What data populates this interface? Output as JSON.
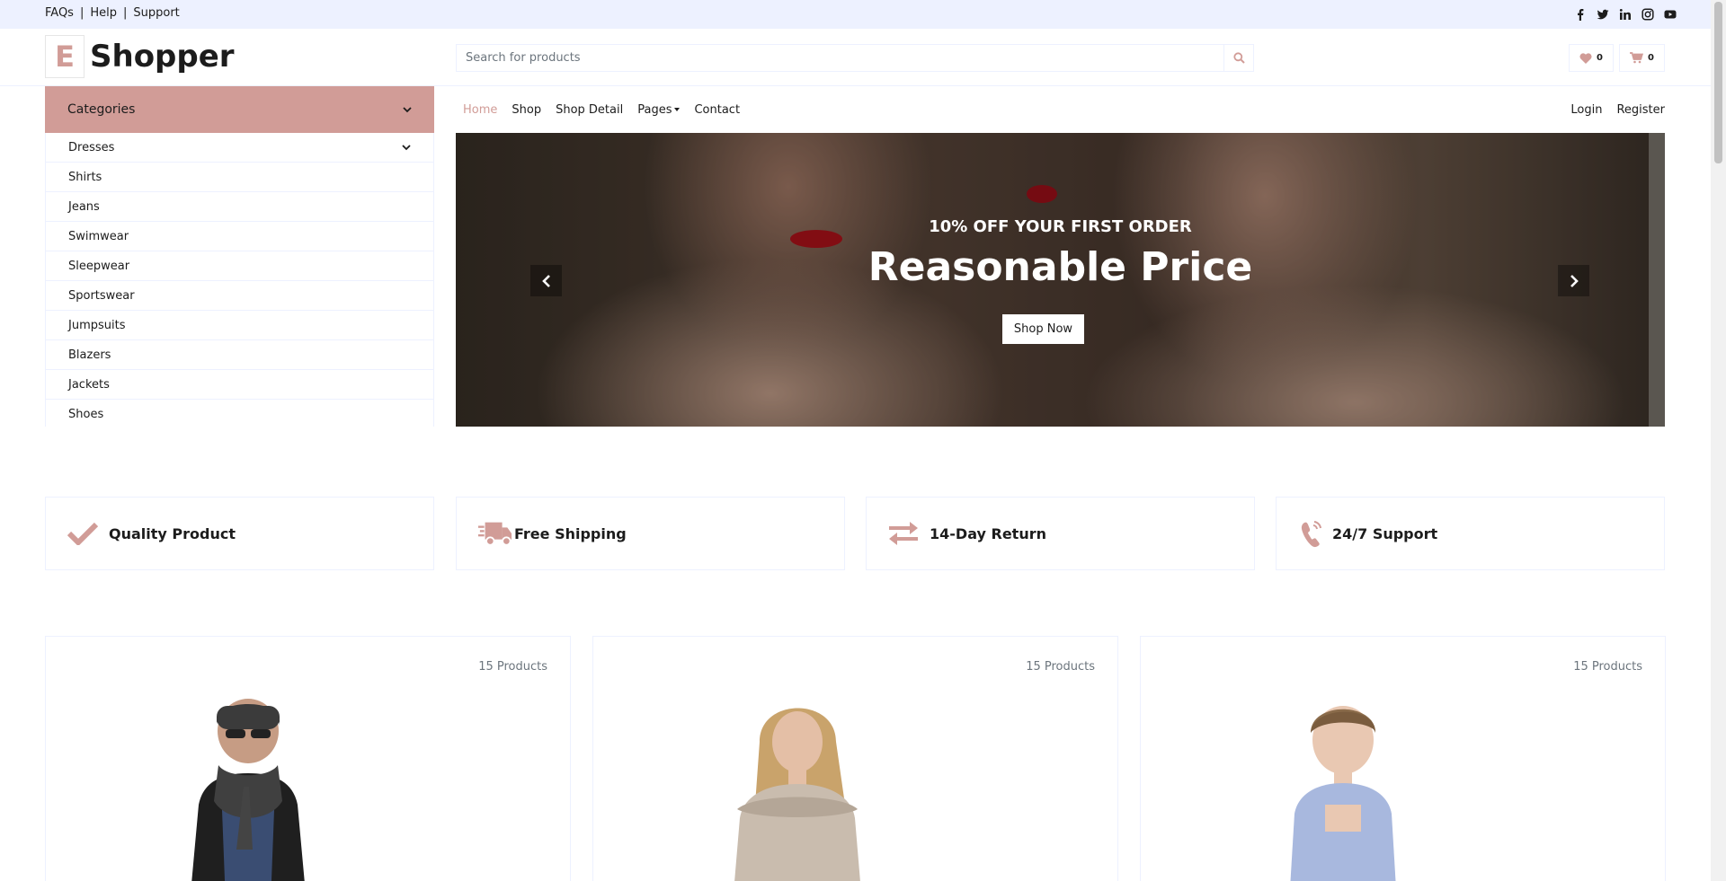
{
  "topbar": {
    "links": [
      "FAQs",
      "Help",
      "Support"
    ],
    "separator": "|",
    "social_icons": [
      "facebook-icon",
      "twitter-icon",
      "linkedin-icon",
      "instagram-icon",
      "youtube-icon"
    ]
  },
  "header": {
    "logo_letter": "E",
    "logo_text": "Shopper",
    "search_placeholder": "Search for products",
    "wishlist_count": "0",
    "cart_count": "0"
  },
  "categories": {
    "label": "Categories",
    "items": [
      "Dresses",
      "Shirts",
      "Jeans",
      "Swimwear",
      "Sleepwear",
      "Sportswear",
      "Jumpsuits",
      "Blazers",
      "Jackets",
      "Shoes"
    ]
  },
  "nav": {
    "items": [
      "Home",
      "Shop",
      "Shop Detail",
      "Pages",
      "Contact"
    ],
    "active": "Home",
    "login": "Login",
    "register": "Register"
  },
  "carousel": {
    "subtitle": "10% OFF YOUR FIRST ORDER",
    "title": "Reasonable Price",
    "cta": "Shop Now"
  },
  "features": [
    {
      "icon": "check-icon",
      "label": "Quality Product"
    },
    {
      "icon": "truck-icon",
      "label": "Free Shipping"
    },
    {
      "icon": "exchange-icon",
      "label": "14-Day Return"
    },
    {
      "icon": "phone-icon",
      "label": "24/7 Support"
    }
  ],
  "category_cards": [
    {
      "count": "15 Products",
      "image": "man-in-beanie-and-scarf"
    },
    {
      "count": "15 Products",
      "image": "woman-in-sweater"
    },
    {
      "count": "15 Products",
      "image": "boy-in-shirt"
    }
  ],
  "colors": {
    "accent": "#D19C97",
    "topbar_bg": "#EDF1FF",
    "text": "#1C1C1C"
  }
}
